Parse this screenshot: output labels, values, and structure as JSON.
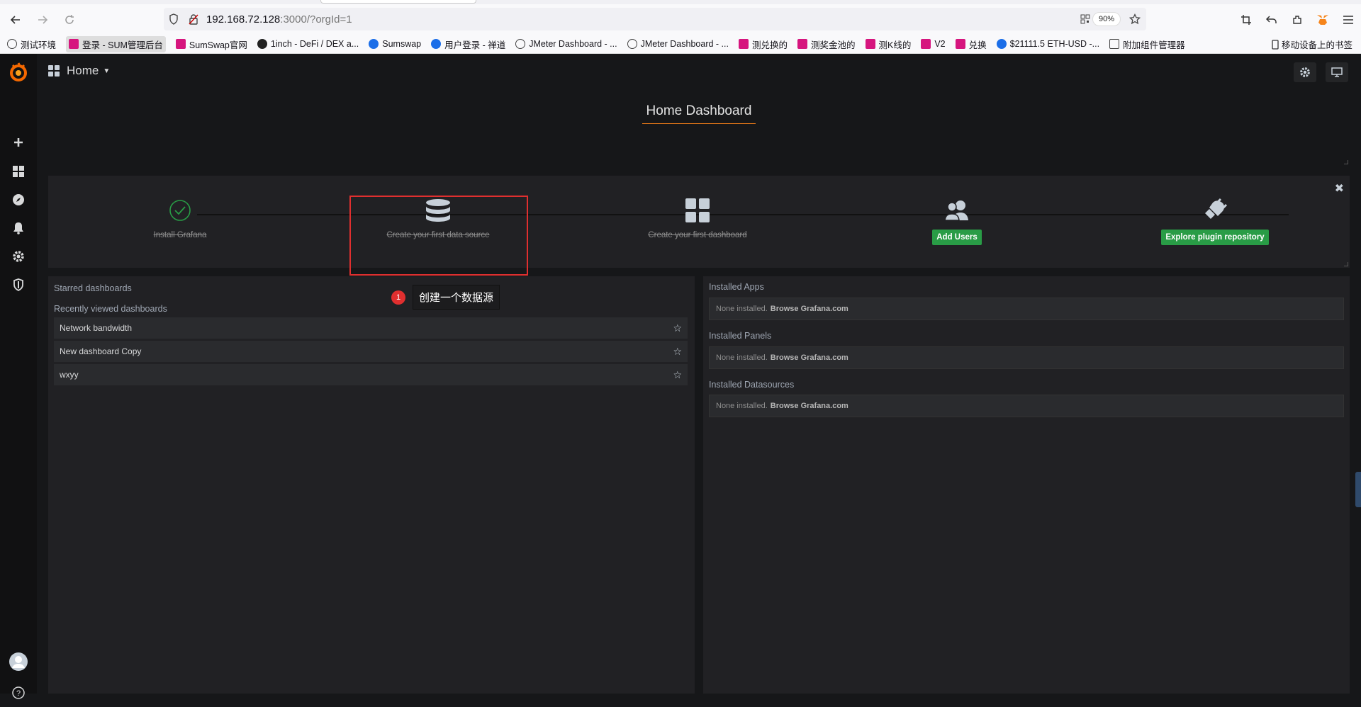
{
  "browser": {
    "url_host": "192.168.72.128",
    "url_rest": ":3000/?orgId=1",
    "zoom": "90%",
    "bookmarks": [
      {
        "label": "测试环境",
        "icon": "globe"
      },
      {
        "label": "登录 - SUM管理后台",
        "icon": "pink",
        "active": true
      },
      {
        "label": "SumSwap官网",
        "icon": "pink"
      },
      {
        "label": "1inch - DeFi / DEX a...",
        "icon": "dark"
      },
      {
        "label": "Sumswap",
        "icon": "blue"
      },
      {
        "label": "用户登录 - 禅道",
        "icon": "blue"
      },
      {
        "label": "JMeter Dashboard - ...",
        "icon": "globe"
      },
      {
        "label": "JMeter Dashboard - ...",
        "icon": "globe"
      },
      {
        "label": "测兑换的",
        "icon": "pink"
      },
      {
        "label": "测奖金池的",
        "icon": "pink"
      },
      {
        "label": "测K线的",
        "icon": "pink"
      },
      {
        "label": "V2",
        "icon": "pink"
      },
      {
        "label": "兑换",
        "icon": "pink"
      },
      {
        "label": "$21111.5 ETH-USD -...",
        "icon": "blue"
      },
      {
        "label": "附加组件管理器",
        "icon": "plug"
      }
    ],
    "mobile_bookmarks": "移动设备上的书签"
  },
  "grafana": {
    "breadcrumb": "Home",
    "title": "Home Dashboard",
    "steps": [
      {
        "label": "Install Grafana",
        "done": true
      },
      {
        "label": "Create your first data source",
        "done": true
      },
      {
        "label": "Create your first dashboard",
        "done": true
      },
      {
        "label": "Add Users",
        "done": false
      },
      {
        "label": "Explore plugin repository",
        "done": false
      }
    ],
    "callout": {
      "number": "1",
      "text": "创建一个数据源"
    },
    "starred_header": "Starred dashboards",
    "recent_header": "Recently viewed dashboards",
    "recent": [
      "Network bandwidth",
      "New dashboard Copy",
      "wxyy"
    ],
    "plugins": {
      "apps_header": "Installed Apps",
      "panels_header": "Installed Panels",
      "datasources_header": "Installed Datasources",
      "none_text": "None installed.",
      "browse_text": "Browse Grafana.com"
    }
  },
  "colors": {
    "accent": "#eb7b18",
    "success": "#299c46",
    "annotation": "#e02f2f"
  }
}
